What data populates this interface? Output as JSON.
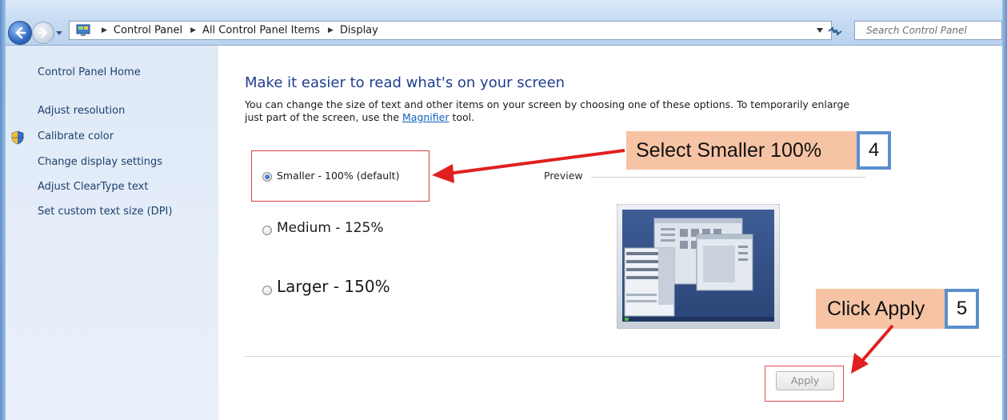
{
  "window": {
    "address_crumbs": [
      "Control Panel",
      "All Control Panel Items",
      "Display"
    ],
    "search_placeholder": "Search Control Panel"
  },
  "sidebar": {
    "home": "Control Panel Home",
    "items": [
      {
        "label": "Adjust resolution",
        "icon": ""
      },
      {
        "label": "Calibrate color",
        "icon": "shield-icon"
      },
      {
        "label": "Change display settings",
        "icon": ""
      },
      {
        "label": "Adjust ClearType text",
        "icon": ""
      },
      {
        "label": "Set custom text size (DPI)",
        "icon": ""
      }
    ]
  },
  "main": {
    "heading": "Make it easier to read what's on your screen",
    "description_prefix": "You can change the size of text and other items on your screen by choosing one of these options. To temporarily enlarge just part of the screen, use the",
    "magnifier_link": "Magnifier",
    "description_suffix": "tool.",
    "options": [
      {
        "label": "Smaller - 100% (default)",
        "selected": true
      },
      {
        "label": "Medium - 125%",
        "selected": false
      },
      {
        "label": "Larger - 150%",
        "selected": false
      }
    ],
    "preview_label": "Preview",
    "apply_label": "Apply"
  },
  "annotations": {
    "callout_select": "Select Smaller 100%",
    "callout_select_step": "4",
    "callout_apply": "Click Apply",
    "callout_apply_step": "5",
    "highlight_color": "#d94040",
    "callout_color": "#f6c4a4",
    "step_border_color": "#5b8fcd"
  }
}
